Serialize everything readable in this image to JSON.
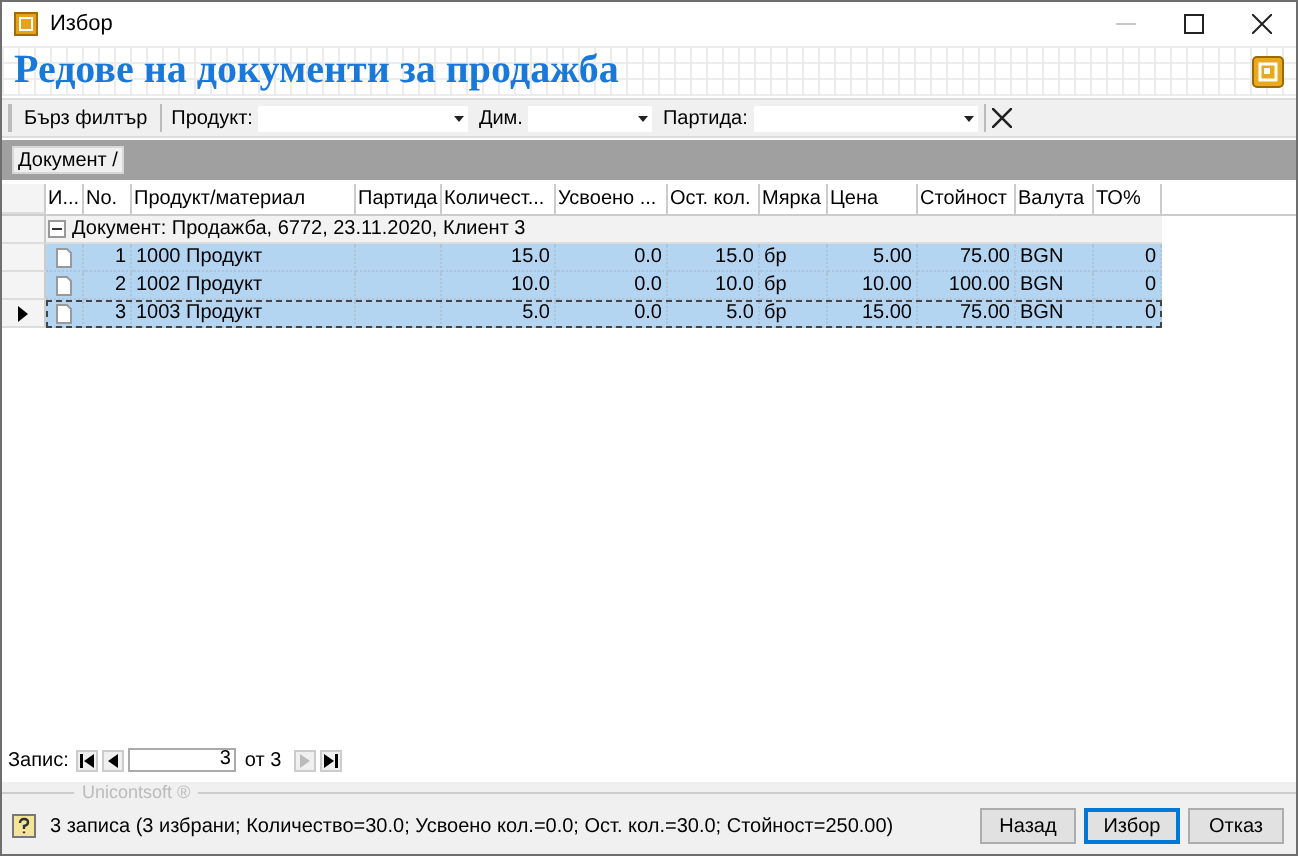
{
  "window": {
    "title": "Избор",
    "controls": [
      {
        "kind": "minimize",
        "disabled": true
      },
      {
        "kind": "maximize",
        "disabled": false
      },
      {
        "kind": "close",
        "disabled": false
      }
    ]
  },
  "header": {
    "title": "Редове на документи за продажба"
  },
  "filter_bar": {
    "quick_filter": "Бърз филтър",
    "fields": [
      {
        "label": "Продукт:"
      },
      {
        "label": "Дим."
      },
      {
        "label": "Партида:"
      }
    ]
  },
  "group_panel": {
    "chip": "Документ /"
  },
  "table": {
    "columns": [
      "И...",
      "No.",
      "Продукт/материал",
      "Партида",
      "Количест...",
      "Усвоено ...",
      "Ост. кол.",
      "Мярка",
      "Цена",
      "Стойност",
      "Валута",
      "ТО%"
    ],
    "group": {
      "label": "Документ: Продажба, 6772, 23.11.2020, Клиент 3",
      "expanded": true
    },
    "rows": [
      {
        "selected": true,
        "current": false,
        "cells": [
          "",
          "1",
          "1000 Продукт",
          "",
          "15.0",
          "0.0",
          "15.0",
          "бр",
          "5.00",
          "75.00",
          "BGN",
          "0"
        ]
      },
      {
        "selected": true,
        "current": false,
        "cells": [
          "",
          "2",
          "1002 Продукт",
          "",
          "10.0",
          "0.0",
          "10.0",
          "бр",
          "10.00",
          "100.00",
          "BGN",
          "0"
        ]
      },
      {
        "selected": true,
        "current": true,
        "cells": [
          "",
          "3",
          "1003 Продукт",
          "",
          "5.0",
          "0.0",
          "5.0",
          "бр",
          "15.00",
          "75.00",
          "BGN",
          "0"
        ]
      }
    ]
  },
  "navigator": {
    "label": "Запис:",
    "value": "3",
    "of": "от 3",
    "buttons": [
      {
        "kind": "first",
        "disabled": false
      },
      {
        "kind": "prev",
        "disabled": false
      },
      {
        "kind": "next",
        "disabled": true
      },
      {
        "kind": "last",
        "disabled": false
      }
    ]
  },
  "footer": {
    "brand": "Unicontsoft ®",
    "status": "3 записа (3 избрани; Количество=30.0; Усвоено кол.=0.0; Ост. кол.=30.0; Стойност=250.00)",
    "buttons": [
      {
        "label": "Назад",
        "default": false
      },
      {
        "label": "Избор",
        "default": true
      },
      {
        "label": "Отказ",
        "default": false
      }
    ]
  }
}
